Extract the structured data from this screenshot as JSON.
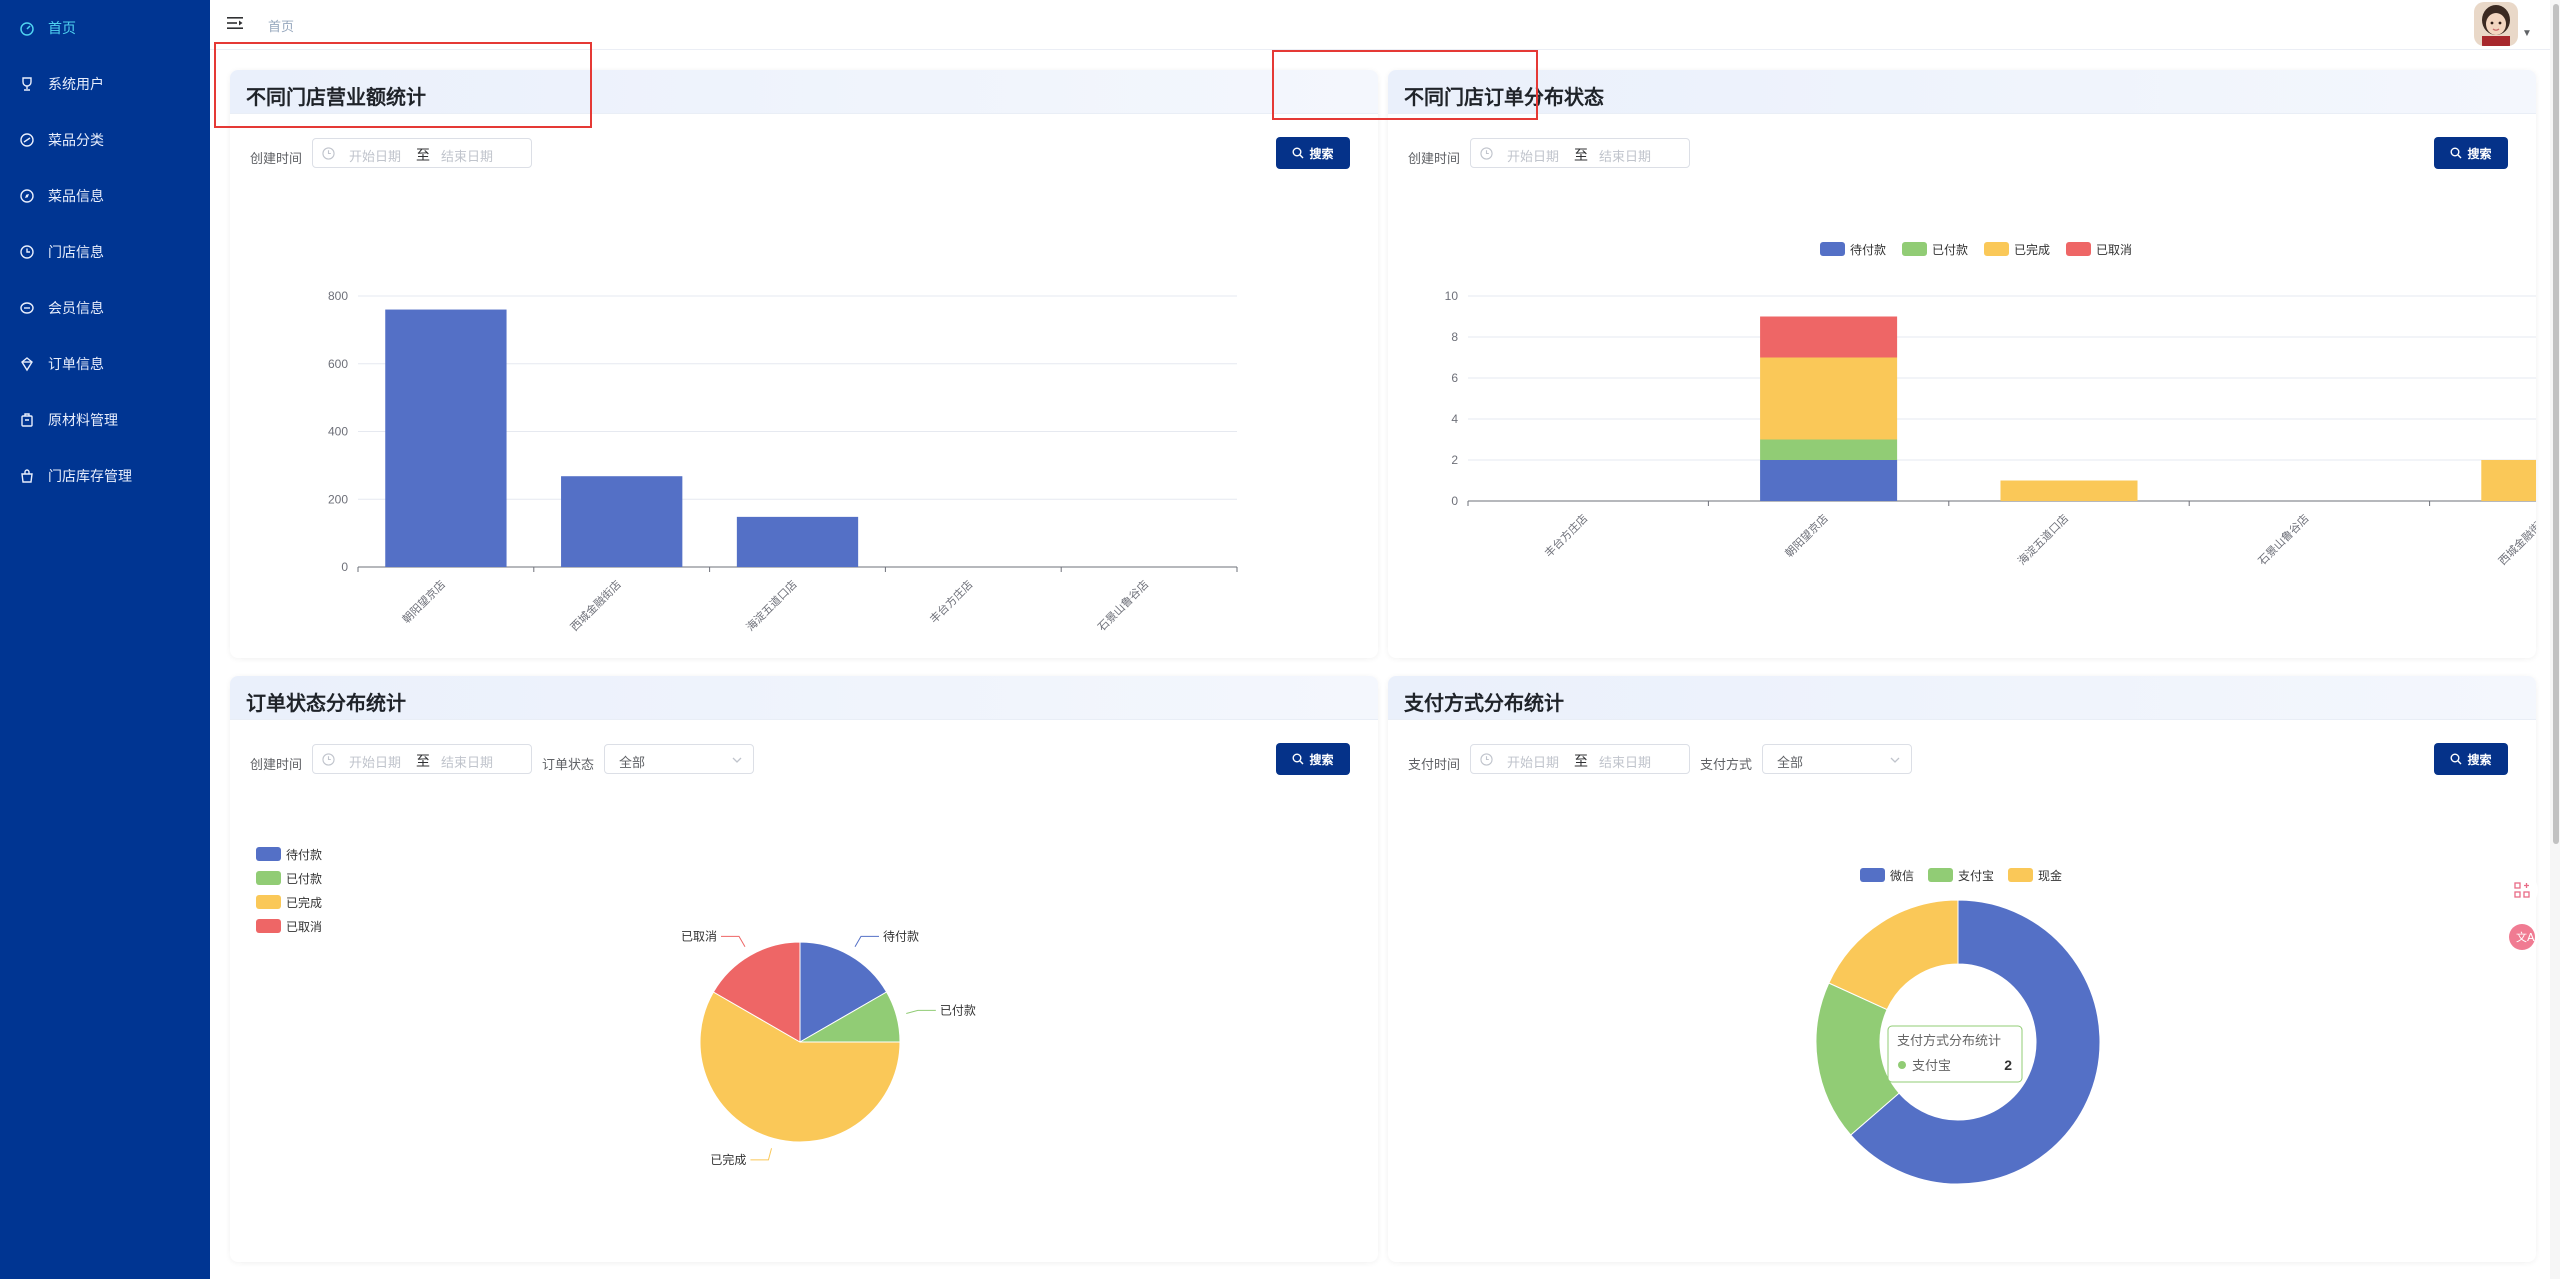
{
  "sidebar": {
    "items": [
      {
        "label": "首页",
        "icon": "dashboard-icon",
        "active": true
      },
      {
        "label": "系统用户",
        "icon": "trophy-icon"
      },
      {
        "label": "菜品分类",
        "icon": "dish-category-icon"
      },
      {
        "label": "菜品信息",
        "icon": "compass-icon"
      },
      {
        "label": "门店信息",
        "icon": "clock-icon"
      },
      {
        "label": "会员信息",
        "icon": "coin-icon"
      },
      {
        "label": "订单信息",
        "icon": "order-icon"
      },
      {
        "label": "原材料管理",
        "icon": "material-icon"
      },
      {
        "label": "门店库存管理",
        "icon": "shopping-bag-icon"
      }
    ]
  },
  "header": {
    "breadcrumb": "首页"
  },
  "common": {
    "search_label": "搜索",
    "start_placeholder": "开始日期",
    "range_sep": "至",
    "end_placeholder": "结束日期"
  },
  "cards": {
    "revenue": {
      "title": "不同门店营业额统计",
      "date_label": "创建时间"
    },
    "order_status_by_store": {
      "title": "不同门店订单分布状态",
      "date_label": "创建时间"
    },
    "order_status": {
      "title": "订单状态分布统计",
      "date_label": "创建时间",
      "status_label": "订单状态",
      "status_value": "全部"
    },
    "payment": {
      "title": "支付方式分布统计",
      "date_label": "支付时间",
      "method_label": "支付方式",
      "method_value": "全部"
    }
  },
  "colors": {
    "blue": "#5470c6",
    "green": "#91cc75",
    "yellow": "#fac858",
    "red": "#ee6666",
    "sidebar": "#003592",
    "active": "#4fd2f0",
    "button": "#053289"
  },
  "chart_data": [
    {
      "type": "bar",
      "title": "",
      "categories": [
        "朝阳望京店",
        "西城金融街店",
        "海淀五道口店",
        "丰台方庄店",
        "石景山鲁谷店"
      ],
      "values": [
        760,
        268,
        148,
        0,
        0
      ],
      "ylim": [
        0,
        800
      ],
      "yticks": [
        "0",
        "200",
        "400",
        "600",
        "800"
      ],
      "grid": true
    },
    {
      "type": "bar",
      "stacked": true,
      "title": "",
      "categories": [
        "丰台方庄店",
        "朝阳望京店",
        "海淀五道口店",
        "石景山鲁谷店",
        "西城金融街店"
      ],
      "series": [
        {
          "name": "待付款",
          "values": [
            0,
            2,
            0,
            0,
            0
          ]
        },
        {
          "name": "已付款",
          "values": [
            0,
            1,
            0,
            0,
            0
          ]
        },
        {
          "name": "已完成",
          "values": [
            0,
            4,
            1,
            0,
            2
          ]
        },
        {
          "name": "已取消",
          "values": [
            0,
            2,
            0,
            0,
            0
          ]
        }
      ],
      "ylim": [
        0,
        10
      ],
      "yticks": [
        "0",
        "2",
        "4",
        "6",
        "8",
        "10"
      ],
      "legend": "top-center",
      "grid": true
    },
    {
      "type": "pie",
      "title": "",
      "slices": [
        {
          "name": "待付款",
          "value": 2
        },
        {
          "name": "已付款",
          "value": 1
        },
        {
          "name": "已完成",
          "value": 7
        },
        {
          "name": "已取消",
          "value": 2
        }
      ],
      "legend": "top-left"
    },
    {
      "type": "pie",
      "donut": true,
      "title": "",
      "slices": [
        {
          "name": "微信",
          "value": 7
        },
        {
          "name": "支付宝",
          "value": 2
        },
        {
          "name": "现金",
          "value": 2
        }
      ],
      "legend": "top-center",
      "tooltip": {
        "title": "支付方式分布统计",
        "name": "支付宝",
        "value": "2"
      }
    }
  ]
}
